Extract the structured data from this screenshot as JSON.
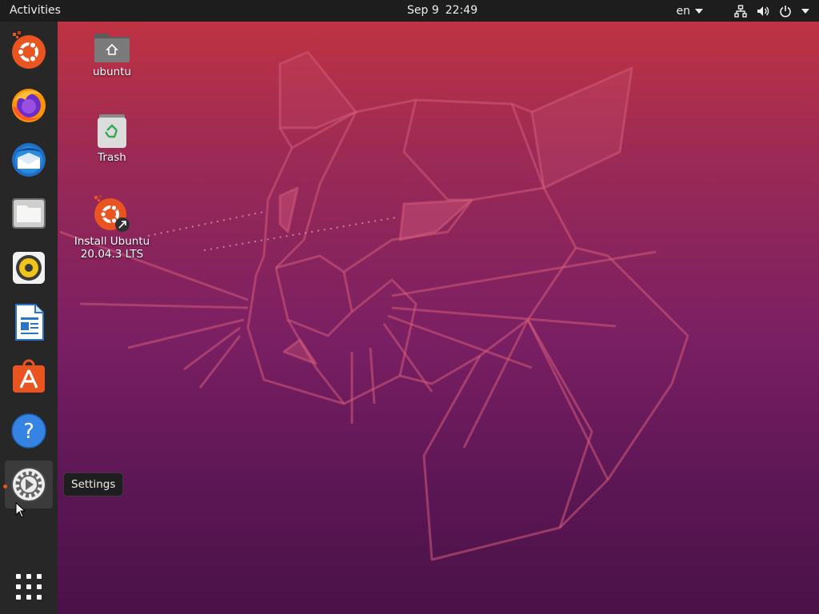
{
  "topbar": {
    "activities_label": "Activities",
    "date": "Sep 9",
    "time": "22:49",
    "language": "en"
  },
  "dock": {
    "items": [
      {
        "name": "Ubuntu installer",
        "icon": "ubuntu-installer-icon"
      },
      {
        "name": "Firefox",
        "icon": "firefox-icon"
      },
      {
        "name": "Thunderbird",
        "icon": "thunderbird-icon"
      },
      {
        "name": "Files",
        "icon": "files-icon"
      },
      {
        "name": "Rhythmbox",
        "icon": "rhythmbox-icon"
      },
      {
        "name": "LibreOffice Writer",
        "icon": "libreoffice-writer-icon"
      },
      {
        "name": "Ubuntu Software",
        "icon": "ubuntu-software-icon"
      },
      {
        "name": "Help",
        "icon": "help-icon"
      },
      {
        "name": "Settings",
        "icon": "settings-icon"
      },
      {
        "name": "Show Applications",
        "icon": "app-grid-icon"
      }
    ],
    "active_item": "Settings",
    "accent_color": "#e95420"
  },
  "desktop": {
    "icons": [
      {
        "label": "ubuntu",
        "icon": "home-folder-icon"
      },
      {
        "label": "Trash",
        "icon": "trash-icon"
      },
      {
        "label_line1": "Install Ubuntu",
        "label_line2": "20.04.3 LTS",
        "icon": "install-ubuntu-icon"
      }
    ]
  },
  "tooltip": {
    "text": "Settings"
  }
}
